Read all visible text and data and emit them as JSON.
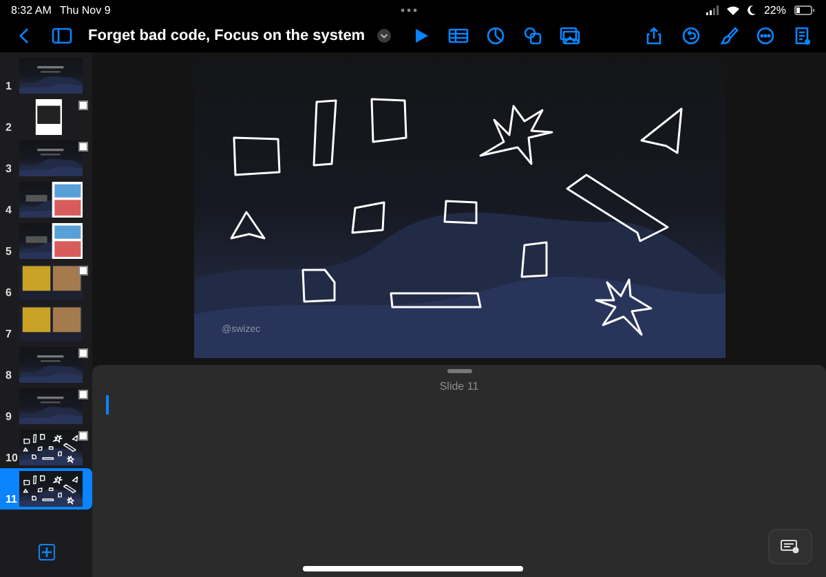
{
  "status_bar": {
    "time": "8:32 AM",
    "date": "Thu Nov 9",
    "battery": "22%"
  },
  "toolbar": {
    "title": "Forget bad code, Focus on the system"
  },
  "slides": [
    {
      "number": "1",
      "kind": "title",
      "selected": false,
      "marked": false
    },
    {
      "number": "2",
      "kind": "screenshot",
      "selected": false,
      "marked": true
    },
    {
      "number": "3",
      "kind": "title",
      "selected": false,
      "marked": true
    },
    {
      "number": "4",
      "kind": "comic",
      "selected": false,
      "marked": false
    },
    {
      "number": "5",
      "kind": "comic",
      "selected": false,
      "marked": false
    },
    {
      "number": "6",
      "kind": "photos",
      "selected": false,
      "marked": true
    },
    {
      "number": "7",
      "kind": "photos",
      "selected": false,
      "marked": false
    },
    {
      "number": "8",
      "kind": "title",
      "selected": false,
      "marked": true
    },
    {
      "number": "9",
      "kind": "title",
      "selected": false,
      "marked": true
    },
    {
      "number": "10",
      "kind": "shapes",
      "selected": false,
      "marked": true
    },
    {
      "number": "11",
      "kind": "shapes",
      "selected": true,
      "marked": false
    }
  ],
  "canvas": {
    "credit": "@swizec"
  },
  "notes": {
    "header": "Slide 11"
  }
}
